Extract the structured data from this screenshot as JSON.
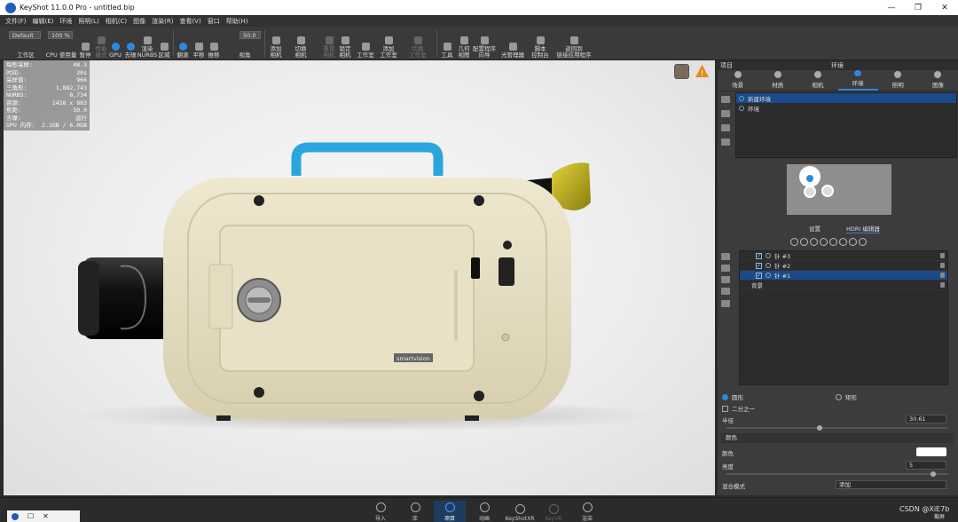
{
  "window": {
    "title": "KeyShot 11.0.0 Pro  - untitled.bip",
    "min": "—",
    "max": "❐",
    "close": "✕"
  },
  "menu": [
    "文件(F)",
    "编辑(E)",
    "环境",
    "照明(L)",
    "相机(C)",
    "图像",
    "渲染(R)",
    "查看(V)",
    "窗口",
    "帮助(H)"
  ],
  "toolbar": {
    "workspace_value": "Default",
    "workspace_label": "工作区",
    "cpu_pct": "100 %",
    "cpu_label": "CPU 使用量",
    "pause": "暂停",
    "perf": "性能\n模式",
    "gpu": "GPU",
    "denoise": "去噪",
    "nurbs": "渲染\nNURBS",
    "region": "区域",
    "tumble": "翻滚",
    "pan": "平移",
    "dolly": "推移",
    "fov_value": "50.0",
    "fov_label": "视角",
    "add_cam": "添加\n相机",
    "switch_cam": "切换\n相机",
    "reset_cam": "重置\n相机",
    "lock_cam": "锁定\n相机",
    "studio": "工作室",
    "add_studio": "添加\n工作室",
    "switch_studio": "切换\n工作室",
    "tools": "工具",
    "geo": "几何\n视图",
    "wizard": "配置程序\n向导",
    "lightmgr": "光管理器",
    "script": "脚本\n控制台",
    "return": "返回到\n链接应用程序"
  },
  "stats": [
    [
      "每秒采样:",
      "48.3"
    ],
    [
      "时间:",
      "20s"
    ],
    [
      "采样值:",
      "966"
    ],
    [
      "三角形:",
      "1,882,743"
    ],
    [
      "NURBS:",
      "8,734"
    ],
    [
      "资源:",
      "1428 x 803"
    ],
    [
      "焦距:",
      "50.0"
    ],
    [
      "去噪:",
      "运行"
    ],
    [
      "GPU 内存:",
      "2.1GB / 6.0GB"
    ]
  ],
  "camera_label": "smartvision",
  "panel": {
    "title_left": "项目",
    "title_center": "环境",
    "tabs": [
      "场景",
      "材质",
      "相机",
      "环境",
      "照明",
      "图像"
    ],
    "env_items": [
      "新建环境",
      "环境"
    ],
    "subtabs": [
      "设置",
      "HDRI 编辑器"
    ],
    "lights": [
      {
        "name": "针 #3"
      },
      {
        "name": "针 #2"
      },
      {
        "name": "针 #1"
      },
      {
        "name": "背景"
      }
    ],
    "shape_circle": "圆形",
    "shape_rect": "矩形",
    "half": "二分之一",
    "radius_label": "半径",
    "radius_value": "30.61",
    "color_section": "颜色",
    "color_label": "颜色",
    "brightness_label": "亮度",
    "brightness_value": "5",
    "blend_label": "混合模式",
    "blend_value": "添加"
  },
  "bottombar": [
    {
      "label": "导入"
    },
    {
      "label": "库"
    },
    {
      "label": "项目"
    },
    {
      "label": "动画"
    },
    {
      "label": "KeyShotXR"
    },
    {
      "label": "KeyVR"
    },
    {
      "label": "渲染"
    }
  ],
  "bottom_right": "截屏",
  "watermark": "CSDN @XiE7b"
}
